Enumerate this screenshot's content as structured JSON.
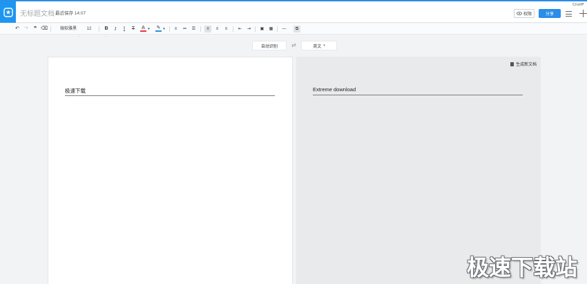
{
  "header": {
    "doc_title": "无标题文档",
    "save_status": "最近保存 14:07",
    "user_name": "Crush",
    "permission_label": "权限",
    "share_label": "分享"
  },
  "toolbar": {
    "font_family": "微软雅黑",
    "font_size": "12",
    "bold": "B",
    "italic": "I",
    "strikethrough": "T",
    "font_color": "A",
    "highlight_color": "#2a8ee8",
    "font_color_value": "#e33333"
  },
  "translate": {
    "source_lang": "自动识别",
    "swap_symbol": "⇄",
    "target_lang": "英文"
  },
  "left_page": {
    "text": "极速下载"
  },
  "right_page": {
    "text": "Extreme download",
    "generate_label": "生成新文档"
  },
  "watermark": {
    "text": "极速下载站"
  }
}
